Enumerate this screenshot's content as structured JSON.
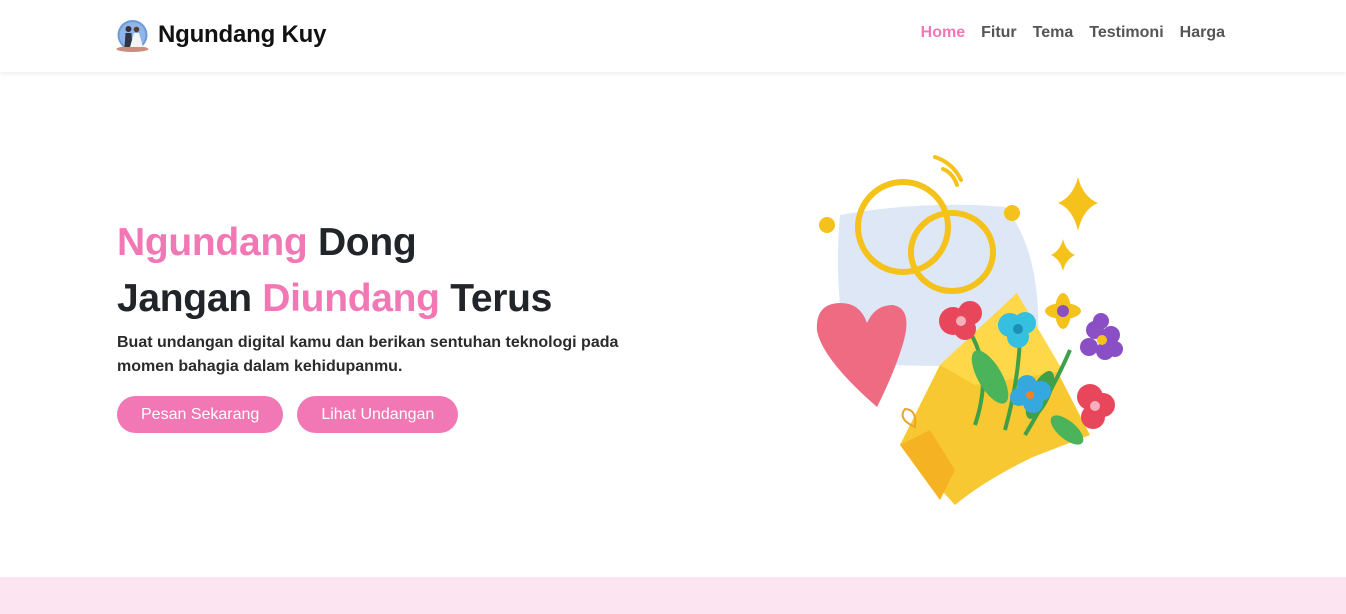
{
  "brand": {
    "name": "Ngundang Kuy",
    "logo_icon": "couple-wedding-logo-icon"
  },
  "nav": {
    "items": [
      {
        "label": "Home",
        "active": true
      },
      {
        "label": "Fitur",
        "active": false
      },
      {
        "label": "Tema",
        "active": false
      },
      {
        "label": "Testimoni",
        "active": false
      },
      {
        "label": "Harga",
        "active": false
      }
    ]
  },
  "hero": {
    "title_line1_highlight": "Ngundang",
    "title_line1_rest": " Dong",
    "title_line2_start": "Jangan ",
    "title_line2_highlight": "Diundang",
    "title_line2_end": " Terus",
    "description": "Buat undangan digital kamu dan berikan sentuhan teknologi pada momen bahagia dalam kehidupanmu.",
    "primary_button": "Pesan Sekarang",
    "secondary_button": "Lihat Undangan",
    "illustration_icon": "wedding-rings-bouquet-illustration-icon"
  },
  "colors": {
    "accent": "#f177b5",
    "band": "#fce4f1",
    "text": "#212529",
    "nav_text": "#555555"
  }
}
